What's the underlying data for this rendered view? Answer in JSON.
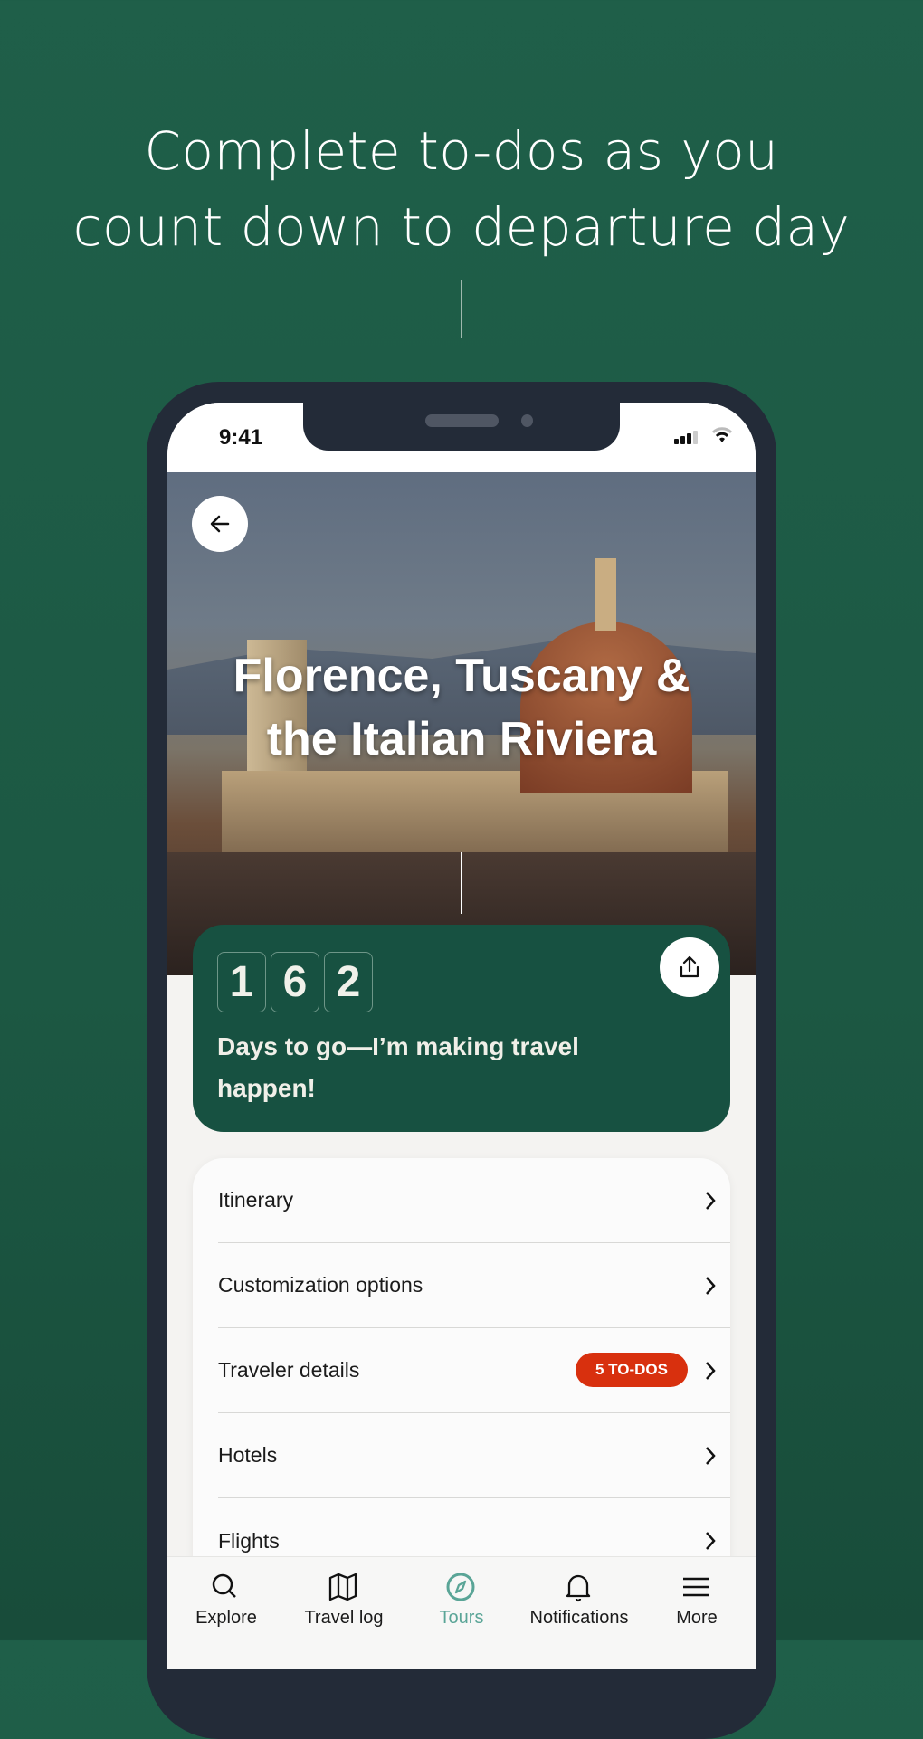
{
  "headline": {
    "line1": "Complete to-dos as you",
    "line2": "count down to departure day"
  },
  "status_bar": {
    "time": "9:41"
  },
  "hero": {
    "title_line1": "Florence, Tuscany &",
    "title_line2": "the Italian Riviera",
    "back_icon": "arrow-left-icon"
  },
  "countdown": {
    "digits": [
      "1",
      "6",
      "2"
    ],
    "message": "Days to go—I’m making travel happen!",
    "share_icon": "share-icon",
    "bg_color": "#175141"
  },
  "menu": {
    "items": [
      {
        "label": "Itinerary"
      },
      {
        "label": "Customization options"
      },
      {
        "label": "Traveler details",
        "badge": "5 TO-DOS"
      },
      {
        "label": "Hotels"
      },
      {
        "label": "Flights"
      }
    ],
    "badge_color": "#d8300e"
  },
  "tabbar": {
    "active": "Tours",
    "accent": "#5aa597",
    "tabs": [
      {
        "label": "Explore",
        "icon": "search-icon"
      },
      {
        "label": "Travel log",
        "icon": "map-icon"
      },
      {
        "label": "Tours",
        "icon": "compass-icon"
      },
      {
        "label": "Notifications",
        "icon": "bell-icon"
      },
      {
        "label": "More",
        "icon": "menu-icon"
      }
    ]
  }
}
